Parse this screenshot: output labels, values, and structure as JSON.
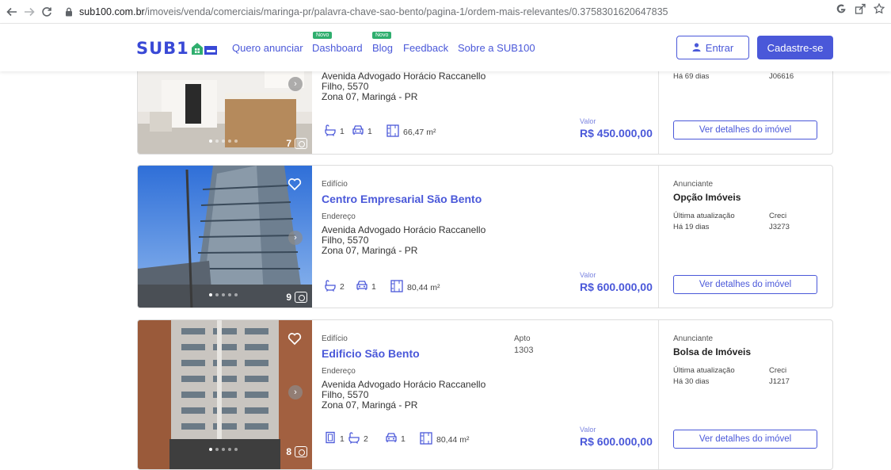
{
  "browser": {
    "url_host": "sub100.com.br",
    "url_path": "/imoveis/venda/comerciais/maringa-pr/palavra-chave-sao-bento/pagina-1/ordem-mais-relevantes/0.3758301620647835",
    "icons": [
      "back-icon",
      "forward-icon",
      "reload-icon",
      "lock-icon",
      "google-icon",
      "share-icon",
      "star-icon"
    ]
  },
  "header": {
    "logo": "SUB1",
    "nav": [
      {
        "label": "Quero anunciar",
        "badge": ""
      },
      {
        "label": "Dashboard",
        "badge": "Novo"
      },
      {
        "label": "Blog",
        "badge": "Novo"
      },
      {
        "label": "Feedback",
        "badge": ""
      },
      {
        "label": "Sobre a SUB100",
        "badge": ""
      }
    ],
    "login_label": "Entrar",
    "signup_label": "Cadastre-se",
    "colors": {
      "accent": "#4a58d9",
      "badge": "#2fae6e"
    }
  },
  "listings": [
    {
      "address_line1": "Avenida Advogado Horácio Raccanello",
      "address_line2": "Filho, 5570",
      "address_line3": "Zona 07, Maringá - PR",
      "bathrooms": "1",
      "parking": "1",
      "area": "66,47 m²",
      "price_label": "Valor",
      "price": "R$ 450.000,00",
      "photo_count": "7",
      "last_update": "Há 69 dias",
      "creci": "J06616",
      "details_label": "Ver detalhes do imóvel"
    },
    {
      "type": "Edifício",
      "title": "Centro Empresarial São Bento",
      "address_label": "Endereço",
      "address_line1": "Avenida Advogado Horácio Raccanello",
      "address_line2": "Filho, 5570",
      "address_line3": "Zona 07, Maringá - PR",
      "bathrooms": "2",
      "parking": "1",
      "area": "80,44 m²",
      "price_label": "Valor",
      "price": "R$ 600.000,00",
      "photo_count": "9",
      "advertiser_label": "Anunciante",
      "advertiser": "Opção Imóveis",
      "last_update_label": "Última atualização",
      "last_update": "Há 19 dias",
      "creci_label": "Creci",
      "creci": "J3273",
      "details_label": "Ver detalhes do imóvel"
    },
    {
      "type": "Edifício",
      "title": "Edificio São Bento",
      "apto_label": "Apto",
      "apto": "1303",
      "address_label": "Endereço",
      "address_line1": "Avenida Advogado Horácio Raccanello",
      "address_line2": "Filho, 5570",
      "address_line3": "Zona 07, Maringá - PR",
      "rooms": "1",
      "bathrooms": "2",
      "parking": "1",
      "area": "80,44 m²",
      "price_label": "Valor",
      "price": "R$ 600.000,00",
      "photo_count": "8",
      "advertiser_label": "Anunciante",
      "advertiser": "Bolsa de Imóveis",
      "last_update_label": "Última atualização",
      "last_update": "Há 30 dias",
      "creci_label": "Creci",
      "creci": "J1217",
      "details_label": "Ver detalhes do imóvel"
    }
  ]
}
